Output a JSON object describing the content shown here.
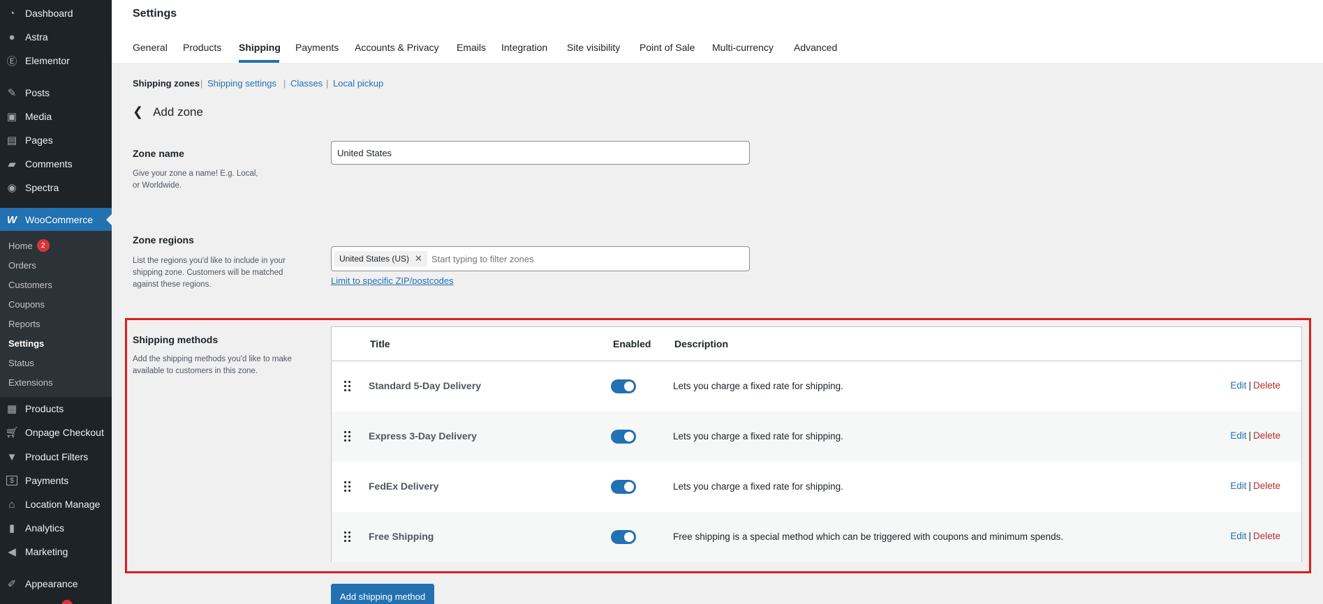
{
  "sidebar": {
    "items_top": [
      {
        "label": "Dashboard",
        "icon": "dashboard-icon"
      },
      {
        "label": "Astra",
        "icon": "astra-icon"
      },
      {
        "label": "Elementor",
        "icon": "elementor-icon"
      },
      {
        "label": "Posts",
        "icon": "pin-icon"
      },
      {
        "label": "Media",
        "icon": "media-icon"
      },
      {
        "label": "Pages",
        "icon": "pages-icon"
      },
      {
        "label": "Comments",
        "icon": "comments-icon"
      },
      {
        "label": "Spectra",
        "icon": "spectra-icon"
      },
      {
        "label": "WooCommerce",
        "icon": "woocommerce-icon"
      }
    ],
    "woo_submenu": [
      {
        "label": "Home",
        "badge": "2"
      },
      {
        "label": "Orders"
      },
      {
        "label": "Customers"
      },
      {
        "label": "Coupons"
      },
      {
        "label": "Reports"
      },
      {
        "label": "Settings"
      },
      {
        "label": "Status"
      },
      {
        "label": "Extensions"
      }
    ],
    "items_bottom": [
      {
        "label": "Products",
        "icon": "products-icon"
      },
      {
        "label": "Onpage Checkout",
        "icon": "cart-icon"
      },
      {
        "label": "Product Filters",
        "icon": "filter-icon"
      },
      {
        "label": "Payments",
        "icon": "payments-icon"
      },
      {
        "label": "Location Manage",
        "icon": "location-icon"
      },
      {
        "label": "Analytics",
        "icon": "analytics-icon"
      },
      {
        "label": "Marketing",
        "icon": "megaphone-icon"
      },
      {
        "label": "Appearance",
        "icon": "brush-icon"
      }
    ]
  },
  "header": {
    "title": "Settings",
    "tabs": [
      "General",
      "Products",
      "Shipping",
      "Payments",
      "Accounts & Privacy",
      "Emails",
      "Integration",
      "Site visibility",
      "Point of Sale",
      "Multi-currency",
      "Advanced"
    ],
    "active_tab": "Shipping"
  },
  "subnav": {
    "items": [
      "Shipping zones",
      "Shipping settings",
      "Classes",
      "Local pickup"
    ],
    "separator": "|"
  },
  "back": {
    "label": "Add zone"
  },
  "zone_name": {
    "title": "Zone name",
    "desc_line1": "Give your zone a name! E.g. Local,",
    "desc_line2": "or Worldwide.",
    "value": "United States"
  },
  "zone_regions": {
    "title": "Zone regions",
    "desc_line1": "List the regions you'd like to include in your",
    "desc_line2": "shipping zone. Customers will be matched",
    "desc_line3": "against these regions.",
    "chip": "United States (US)",
    "placeholder": "Start typing to filter zones",
    "zip_link": "Limit to specific ZIP/postcodes"
  },
  "shipping_methods": {
    "title": "Shipping methods",
    "desc_line1": "Add the shipping methods you'd like to make",
    "desc_line2": "available to customers in this zone.",
    "columns": [
      "Title",
      "Enabled",
      "Description"
    ],
    "rows": [
      {
        "title": "Standard 5-Day Delivery",
        "description": "Lets you charge a fixed rate for shipping.",
        "enabled": true
      },
      {
        "title": "Express 3-Day Delivery",
        "description": "Lets you charge a fixed rate for shipping.",
        "enabled": true
      },
      {
        "title": "FedEx Delivery",
        "description": "Lets you charge a fixed rate for shipping.",
        "enabled": true
      },
      {
        "title": "Free Shipping",
        "description": "Free shipping is a special method which can be triggered with coupons and minimum spends.",
        "enabled": true
      }
    ],
    "edit_label": "Edit",
    "delete_label": "Delete",
    "add_button": "Add shipping method"
  },
  "colors": {
    "accent": "#2271b1",
    "sidebar": "#1d2327",
    "highlight": "#d9201c",
    "delete": "#b32d2e"
  }
}
